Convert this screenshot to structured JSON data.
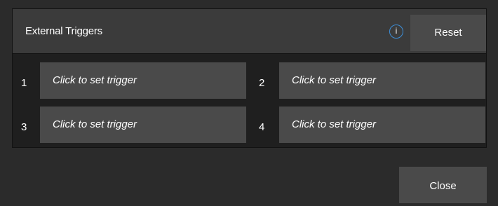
{
  "panel": {
    "title": "External Triggers",
    "info_glyph": "i",
    "reset_label": "Reset"
  },
  "triggers": [
    {
      "number": "1",
      "label": "Click to set trigger"
    },
    {
      "number": "2",
      "label": "Click to set trigger"
    },
    {
      "number": "3",
      "label": "Click to set trigger"
    },
    {
      "number": "4",
      "label": "Click to set trigger"
    }
  ],
  "footer": {
    "close_label": "Close"
  },
  "colors": {
    "background": "#2b2b2b",
    "panel": "#1f1f1f",
    "header": "#3b3b3b",
    "button": "#4a4a4a",
    "info_accent": "#3c8ed8"
  }
}
